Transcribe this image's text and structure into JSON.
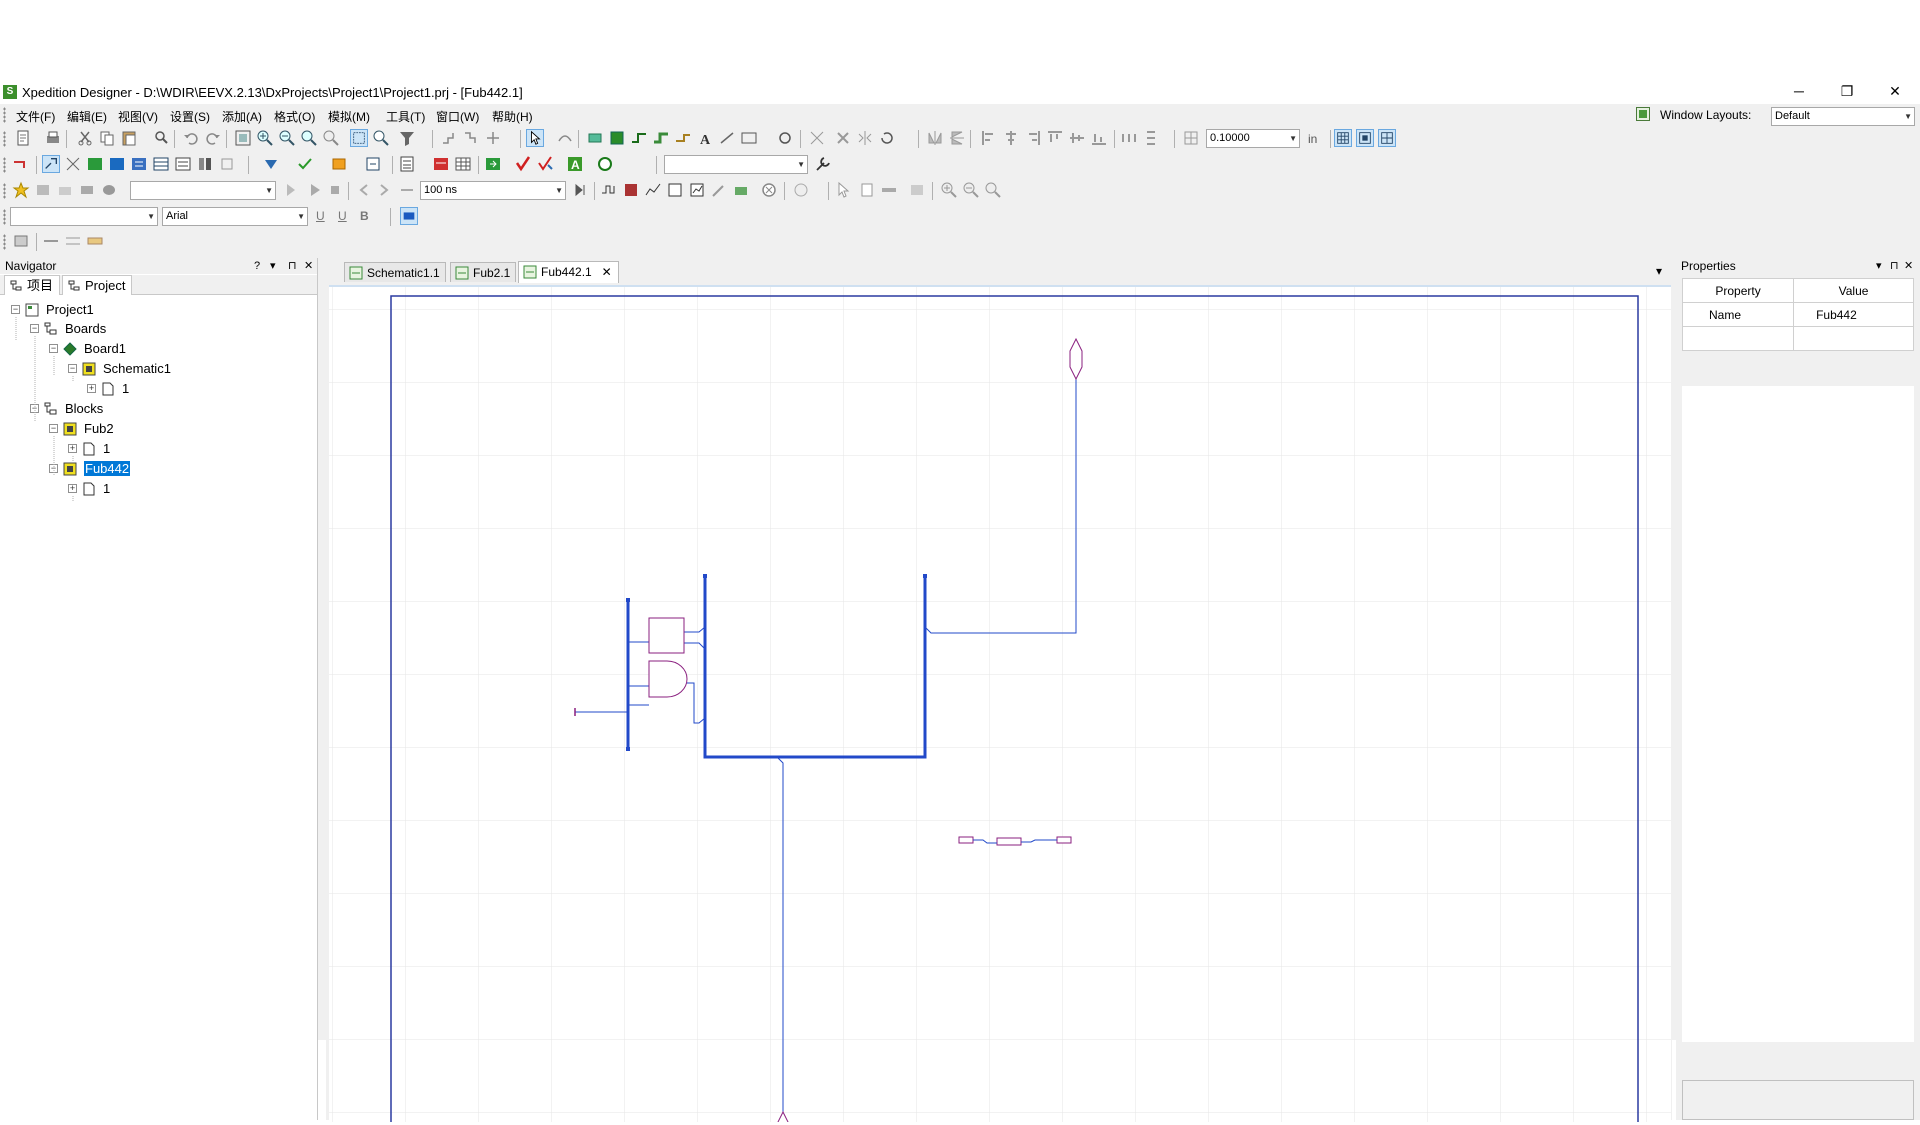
{
  "window": {
    "title": "Xpedition Designer - D:\\WDIR\\EEVX.2.13\\DxProjects\\Project1\\Project1.prj - [Fub442.1]",
    "app_icon_letter": "S",
    "minimize": "─",
    "restore": "❐",
    "close": "✕"
  },
  "menu": [
    "文件(F)",
    "编辑(E)",
    "视图(V)",
    "设置(S)",
    "添加(A)",
    "格式(O)",
    "模拟(M)",
    "工具(T)",
    "窗口(W)",
    "帮助(H)"
  ],
  "window_layouts": {
    "label": "Window Layouts:",
    "value": "Default"
  },
  "toolbar": {
    "grid_value": "0.10000",
    "grid_unit": "in",
    "sim_time": "100 ns",
    "font_name": "Arial",
    "underline": "U",
    "underline2": "U",
    "bold": "B"
  },
  "navigator": {
    "title": "Navigator",
    "help": "?",
    "pin": "▾",
    "autohide": "⊓",
    "close": "✕",
    "tabs": [
      "项目",
      "Project"
    ],
    "tree": {
      "project": "Project1",
      "boards": "Boards",
      "board1": "Board1",
      "schematic1": "Schematic1",
      "schematic1_sheet": "1",
      "blocks": "Blocks",
      "fub2": "Fub2",
      "fub2_sheet": "1",
      "fub442": "Fub442",
      "fub442_sheet": "1"
    }
  },
  "doc_tabs": [
    "Schematic1.1",
    "Fub2.1",
    "Fub442.1"
  ],
  "doc_tab_close": "✕",
  "doc_tab_menu": "▾",
  "properties": {
    "title": "Properties",
    "columns": [
      "Property",
      "Value"
    ],
    "rows": [
      {
        "property": "Name",
        "value": "Fub442"
      }
    ]
  },
  "colors": {
    "wire": "#2249c9",
    "symbol": "#8a1f7f",
    "grid": "#e4e4e4",
    "border": "#2a3aa0",
    "selection": "#0078d7"
  }
}
